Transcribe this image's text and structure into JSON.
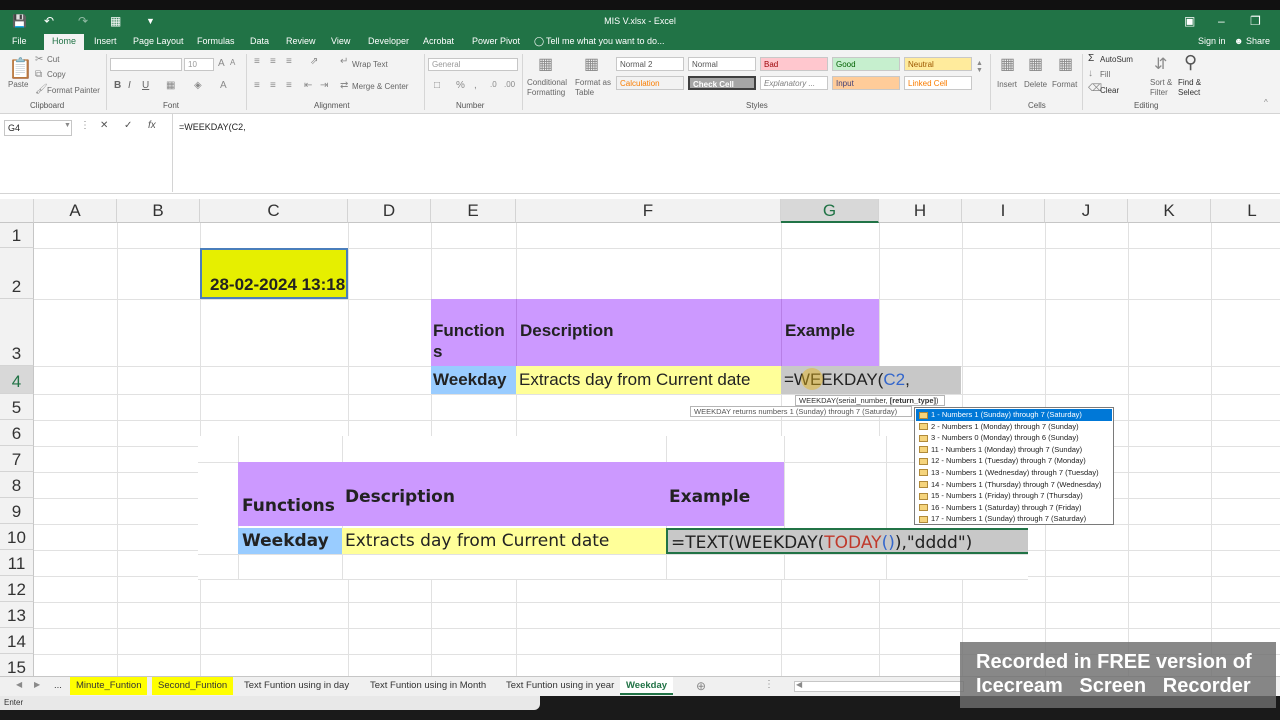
{
  "window": {
    "title": "MIS V.xlsx - Excel"
  },
  "tabs": [
    "File",
    "Home",
    "Insert",
    "Page Layout",
    "Formulas",
    "Data",
    "Review",
    "View",
    "Developer",
    "Acrobat",
    "Power Pivot"
  ],
  "tell_me": "Tell me what you want to do...",
  "signin": "Sign in",
  "share": "Share",
  "ribbon": {
    "paste": "Paste",
    "cut": "Cut",
    "copy": "Copy",
    "format_painter": "Format Painter",
    "clipboard": "Clipboard",
    "font_group": "Font",
    "font_size": "10",
    "bold": "B",
    "italic": "I",
    "underline": "U",
    "wrap_text": "Wrap Text",
    "merge_center": "Merge & Center",
    "alignment": "Alignment",
    "number_format": "General",
    "number": "Number",
    "conditional_formatting": "Conditional Formatting",
    "format_as_table": "Format as Table",
    "styles": "Styles",
    "style_cells": [
      "Normal 2",
      "Normal",
      "Bad",
      "Good",
      "Neutral",
      "Calculation",
      "Check Cell",
      "Explanatory ...",
      "Input",
      "Linked Cell"
    ],
    "insert": "Insert",
    "delete": "Delete",
    "format": "Format",
    "cells": "Cells",
    "autosum": "AutoSum",
    "fill": "Fill",
    "clear": "Clear",
    "sort_filter": "Sort & Filter",
    "find_select": "Find & Select",
    "editing": "Editing"
  },
  "formula_bar": {
    "name_box": "G4",
    "formula": "=WEEKDAY(C2,"
  },
  "columns": [
    "A",
    "B",
    "C",
    "D",
    "E",
    "F",
    "G",
    "H",
    "I",
    "J",
    "K",
    "L"
  ],
  "rows": [
    "1",
    "2",
    "3",
    "4",
    "5",
    "6",
    "7",
    "8",
    "9",
    "10",
    "11",
    "12",
    "13",
    "14",
    "15"
  ],
  "cells": {
    "c2": "28-02-2024 13:18",
    "e3": "Function s",
    "f3": "Description",
    "g3": "Example",
    "e4": "Weekday",
    "f4": "Extracts day from Current date",
    "g4_eq": "=WEEKDAY(",
    "g4_ref": "C2",
    "g4_comma": ","
  },
  "second_table": {
    "h_func": "Functions",
    "h_desc": "Description",
    "h_ex": "Example",
    "r_func": "Weekday",
    "r_desc": "Extracts day from Current date",
    "f_a": "=TEXT(WEEKDAY(",
    "f_b": "TODAY",
    "f_c": "()",
    "f_d": "),\"dddd\")"
  },
  "tooltip": {
    "syntax_pre": "WEEKDAY(serial_number, ",
    "syntax_bold": "[return_type]",
    "syntax_post": ")",
    "description": "WEEKDAY returns numbers 1 (Sunday) through 7 (Saturday)"
  },
  "dropdown": [
    "1 - Numbers 1 (Sunday) through 7 (Saturday)",
    "2 - Numbers 1 (Monday) through 7 (Sunday)",
    "3 - Numbers 0 (Monday) through 6 (Sunday)",
    "11 - Numbers 1 (Monday) through 7 (Sunday)",
    "12 - Numbers 1 (Tuesday) through 7 (Monday)",
    "13 - Numbers 1 (Wednesday) through 7 (Tuesday)",
    "14 - Numbers 1 (Thursday) through 7 (Wednesday)",
    "15 - Numbers 1 (Friday) through 7 (Thursday)",
    "16 - Numbers 1 (Saturday) through 7 (Friday)",
    "17 - Numbers 1 (Sunday) through 7 (Saturday)"
  ],
  "sheet_tabs": {
    "ellipsis": "...",
    "items": [
      "Minute_Funtion",
      "Second_Funtion",
      "Text Funtion using in day",
      "Text Funtion using in Month",
      "Text Funtion using in year",
      "Weekday"
    ]
  },
  "status": "Enter",
  "watermark": {
    "line1": "Recorded in FREE version of",
    "line2": "Icecream   Screen   Recorder"
  },
  "colors": {
    "excel_green": "#217346",
    "cell_yellow": "#ffff99",
    "date_yellow": "#e6ef00",
    "header_purple": "#cc99ff",
    "func_blue": "#99ccff"
  }
}
